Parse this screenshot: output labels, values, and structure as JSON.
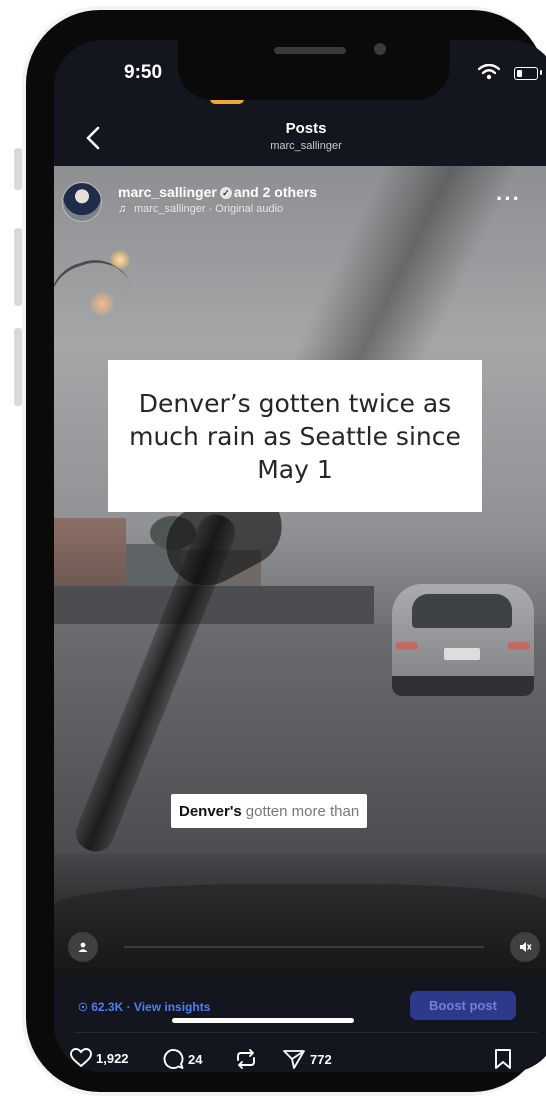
{
  "status_bar": {
    "time": "9:50"
  },
  "header": {
    "title": "Posts",
    "subtitle": "marc_sallinger"
  },
  "post": {
    "username": "marc_sallinger",
    "coauthors": "and 2 others",
    "audio": "marc_sallinger · Original audio",
    "caption": "Denver’s gotten twice as much rain as Seattle since May 1",
    "subtitle_bold": "Denver's",
    "subtitle_rest": "gotten more than"
  },
  "insights": {
    "label": "62.3K · View insights",
    "boost_label": "Boost post"
  },
  "actions": {
    "likes": "1,922",
    "comments": "24",
    "shares": "772"
  },
  "colors": {
    "accent": "#4f7ef2",
    "boost_bg": "#2d3a8c",
    "screen_bg": "#14161f"
  }
}
